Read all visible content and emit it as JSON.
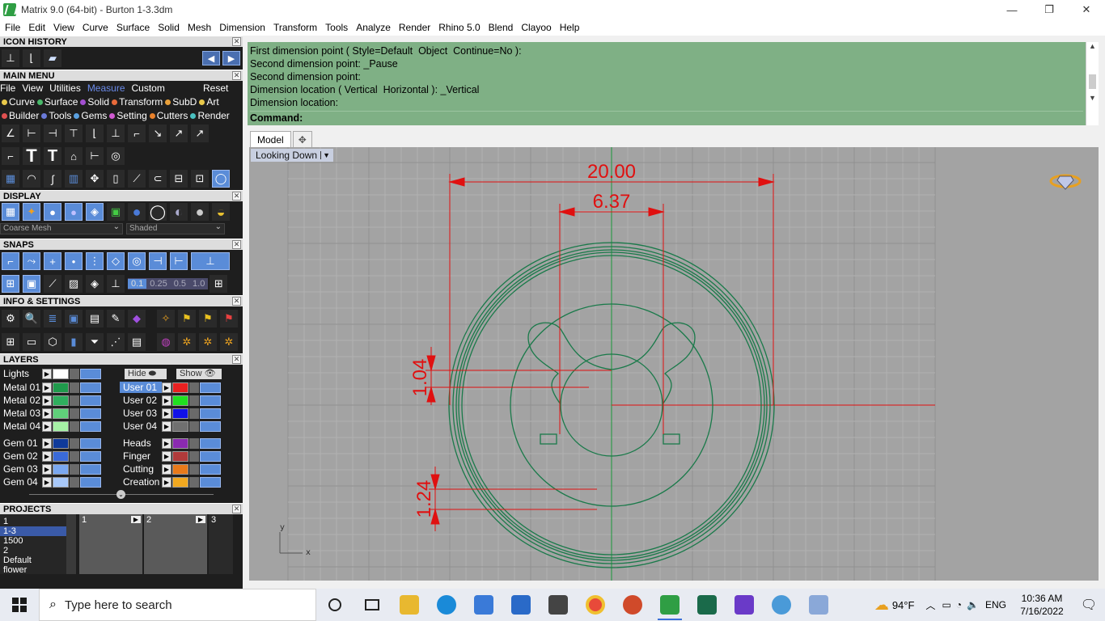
{
  "window": {
    "title": "Matrix 9.0 (64-bit) - Burton 1-3.3dm",
    "minimize": "—",
    "restore": "❐",
    "close": "✕"
  },
  "menubar": [
    "File",
    "Edit",
    "View",
    "Curve",
    "Surface",
    "Solid",
    "Mesh",
    "Dimension",
    "Transform",
    "Tools",
    "Analyze",
    "Render",
    "Rhino 5.0",
    "Blend",
    "Clayoo",
    "Help"
  ],
  "panels": {
    "icon_history": "ICON HISTORY",
    "main_menu": "MAIN MENU",
    "display": "DISPLAY",
    "snaps": "SNAPS",
    "info_settings": "INFO & SETTINGS",
    "layers": "LAYERS",
    "projects": "PROJECTS",
    "close_glyph": "✕"
  },
  "main_menu": {
    "tabs": [
      "File",
      "View",
      "Utilities",
      "Measure",
      "Custom"
    ],
    "active_tab": "Measure",
    "reset": "Reset",
    "categories_row1": [
      {
        "label": "Curve",
        "color": "#e8c84a"
      },
      {
        "label": "Surface",
        "color": "#49b86a"
      },
      {
        "label": "Solid",
        "color": "#a24fd0"
      },
      {
        "label": "Transform",
        "color": "#e86a3a"
      },
      {
        "label": "SubD",
        "color": "#e8a03a"
      },
      {
        "label": "Art",
        "color": "#e8c84a"
      }
    ],
    "categories_row2": [
      {
        "label": "Builder",
        "color": "#e05050"
      },
      {
        "label": "Tools",
        "color": "#6a7ad8"
      },
      {
        "label": "Gems",
        "color": "#5aa0e0"
      },
      {
        "label": "Setting",
        "color": "#d05ad0"
      },
      {
        "label": "Cutters",
        "color": "#e8802a"
      },
      {
        "label": "Render",
        "color": "#4ac0c0"
      }
    ]
  },
  "display": {
    "mesh_select": "Coarse Mesh",
    "shade_select": "Shaded"
  },
  "snaps": {
    "values": [
      "0.1",
      "0.25",
      "0.5",
      "1.0"
    ]
  },
  "layers": {
    "lights": "Lights",
    "hide": "Hide",
    "show": "Show",
    "left": [
      {
        "name": "Metal 01",
        "color": "#1f9a4c"
      },
      {
        "name": "Metal 02",
        "color": "#2fae5e"
      },
      {
        "name": "Metal 03",
        "color": "#5fd07a"
      },
      {
        "name": "Metal 04",
        "color": "#a5f0a5"
      },
      {
        "name": "Gem 01",
        "color": "#0f3a9a"
      },
      {
        "name": "Gem 02",
        "color": "#3a6ad8"
      },
      {
        "name": "Gem 03",
        "color": "#7aa8f0"
      },
      {
        "name": "Gem 04",
        "color": "#a8c8f8"
      }
    ],
    "right": [
      {
        "name": "User 01",
        "color": "#e82020",
        "selected": true
      },
      {
        "name": "User 02",
        "color": "#20e020"
      },
      {
        "name": "User 03",
        "color": "#1010e8"
      },
      {
        "name": "User 04",
        "color": "#707070"
      },
      {
        "name": "Heads",
        "color": "#8a2ab0"
      },
      {
        "name": "Finger",
        "color": "#b03a3a"
      },
      {
        "name": "Cutting",
        "color": "#e87a1a"
      },
      {
        "name": "Creation",
        "color": "#f0a820"
      }
    ]
  },
  "projects": {
    "list": [
      "1",
      "1-3",
      "1500",
      "2",
      "Default",
      "flower"
    ],
    "selected": "1-3",
    "thumbs": [
      "1",
      "2",
      "3"
    ]
  },
  "command": {
    "history": [
      "First dimension point ( Style=Default  Object  Continue=No ):",
      "Second dimension point: _Pause",
      "Second dimension point:",
      "Dimension location ( Vertical  Horizontal ): _Vertical",
      "Dimension location:"
    ],
    "prompt": "Command:"
  },
  "viewtabs": {
    "model": "Model",
    "plus": "✥"
  },
  "viewport": {
    "view_name": "Looking Down",
    "dims": {
      "overall_width": "20.00",
      "inner_width": "6.37",
      "prong_height": "1.04",
      "band_height": "1.24"
    },
    "axis_y": "y",
    "axis_x": "x",
    "colors": {
      "background": "#a3a3a3",
      "grid": "#b0b0b0",
      "curve": "#1a7a4a",
      "dimension": "#e01010",
      "axis_green": "#1a9a3a"
    }
  },
  "taskbar": {
    "search_placeholder": "Type here to search",
    "weather": "94°F",
    "language": "ENG",
    "time": "10:36 AM",
    "date": "7/16/2022"
  }
}
